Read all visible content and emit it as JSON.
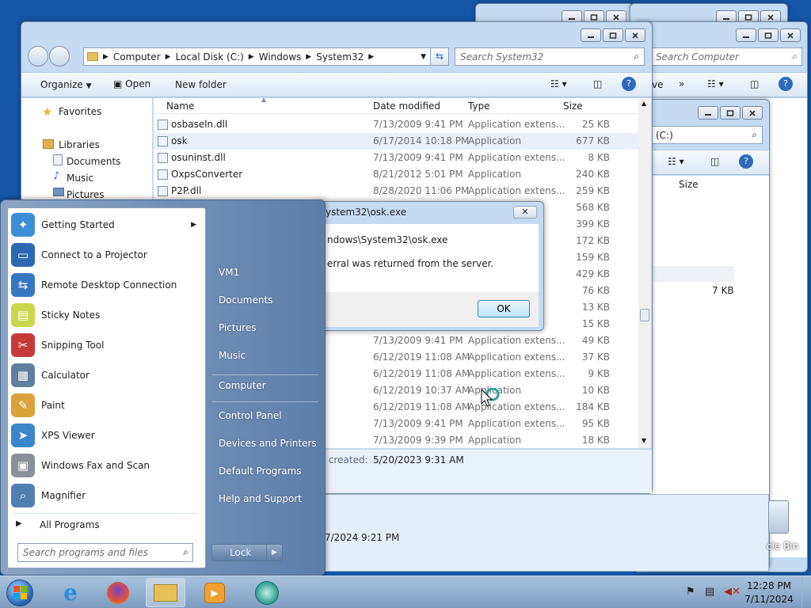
{
  "colors": {
    "desktop": "#1556a6",
    "accent": "#3c7fb1",
    "taskbar": "#8faecf"
  },
  "back_window": {
    "search_placeholder": "Search Computer",
    "toolbar_partial": "ve",
    "column_size": "Size",
    "row_size": "7 KB",
    "date_partial": "7/2024 9:21 PM",
    "drive_partial": "(C:)"
  },
  "recycle_bin": {
    "label": "cle Bin"
  },
  "explorer": {
    "breadcrumb": [
      "Computer",
      "Local Disk (C:)",
      "Windows",
      "System32"
    ],
    "search_placeholder": "Search System32",
    "toolbar": {
      "organize": "Organize",
      "open": "Open",
      "new_folder": "New folder"
    },
    "nav": {
      "favorites": "Favorites",
      "libraries": "Libraries",
      "documents": "Documents",
      "music": "Music",
      "pictures": "Pictures"
    },
    "columns": {
      "name": "Name",
      "date": "Date modified",
      "type": "Type",
      "size": "Size"
    },
    "files": [
      {
        "name": "osbaseln.dll",
        "date": "7/13/2009 9:41 PM",
        "type": "Application extens...",
        "size": "25 KB"
      },
      {
        "name": "osk",
        "date": "6/17/2014 10:18 PM",
        "type": "Application",
        "size": "677 KB"
      },
      {
        "name": "osuninst.dll",
        "date": "7/13/2009 9:41 PM",
        "type": "Application extens...",
        "size": "8 KB"
      },
      {
        "name": "OxpsConverter",
        "date": "8/21/2012 5:01 PM",
        "type": "Application",
        "size": "240 KB"
      },
      {
        "name": "P2P.dll",
        "date": "8/28/2020 11:06 PM",
        "type": "Application extens...",
        "size": "259 KB"
      },
      {
        "name": "",
        "date": "",
        "type": "",
        "size": "568 KB"
      },
      {
        "name": "",
        "date": "",
        "type": "",
        "size": "399 KB"
      },
      {
        "name": "",
        "date": "",
        "type": "",
        "size": "172 KB"
      },
      {
        "name": "",
        "date": "",
        "type": "",
        "size": "159 KB"
      },
      {
        "name": "",
        "date": "",
        "type": "",
        "size": "429 KB"
      },
      {
        "name": "",
        "date": "",
        "type": "",
        "size": "76 KB"
      },
      {
        "name": "",
        "date": "",
        "type": "",
        "size": "13 KB"
      },
      {
        "name": "",
        "date": "",
        "type": "",
        "size": "15 KB"
      },
      {
        "name": "",
        "date": "7/13/2009 9:41 PM",
        "type": "Application extens...",
        "size": "49 KB"
      },
      {
        "name": "",
        "date": "6/12/2019 11:08 AM",
        "type": "Application extens...",
        "size": "37 KB"
      },
      {
        "name": "",
        "date": "6/12/2019 11:08 AM",
        "type": "Application extens...",
        "size": "9 KB"
      },
      {
        "name": "",
        "date": "6/12/2019 10:37 AM",
        "type": "Application",
        "size": "10 KB"
      },
      {
        "name": "",
        "date": "6/12/2019 11:08 AM",
        "type": "Application extens...",
        "size": "184 KB"
      },
      {
        "name": "",
        "date": "7/13/2009 9:41 PM",
        "type": "Application extens...",
        "size": "95 KB"
      },
      {
        "name": "",
        "date": "7/13/2009 9:39 PM",
        "type": "Application",
        "size": "18 KB"
      }
    ],
    "details": {
      "label_partial": "te created:",
      "value": "5/20/2023 9:31 AM"
    }
  },
  "dialog": {
    "title_partial": "ystem32\\osk.exe",
    "path_partial": "ndows\\System32\\osk.exe",
    "message_partial": "erral was returned from the server.",
    "ok": "OK"
  },
  "start_menu": {
    "programs": [
      {
        "label": "Getting Started",
        "icon": "getting-started-icon",
        "color": "#3c8fd6",
        "glyph": "✦",
        "arrow": true
      },
      {
        "label": "Connect to a Projector",
        "icon": "projector-icon",
        "color": "#2b6ab3",
        "glyph": "▭",
        "arrow": false
      },
      {
        "label": "Remote Desktop Connection",
        "icon": "remote-desktop-icon",
        "color": "#3677c2",
        "glyph": "⇆",
        "arrow": false
      },
      {
        "label": "Sticky Notes",
        "icon": "sticky-notes-icon",
        "color": "#c8d84a",
        "glyph": "▤",
        "arrow": false
      },
      {
        "label": "Snipping Tool",
        "icon": "snipping-tool-icon",
        "color": "#c83a3a",
        "glyph": "✂",
        "arrow": false
      },
      {
        "label": "Calculator",
        "icon": "calculator-icon",
        "color": "#5e7f9e",
        "glyph": "▦",
        "arrow": false
      },
      {
        "label": "Paint",
        "icon": "paint-icon",
        "color": "#d9a23a",
        "glyph": "✎",
        "arrow": false
      },
      {
        "label": "XPS Viewer",
        "icon": "xps-viewer-icon",
        "color": "#3a86c8",
        "glyph": "➤",
        "arrow": false
      },
      {
        "label": "Windows Fax and Scan",
        "icon": "fax-scan-icon",
        "color": "#8a8f99",
        "glyph": "▣",
        "arrow": false
      },
      {
        "label": "Magnifier",
        "icon": "magnifier-icon",
        "color": "#4f7fb0",
        "glyph": "⌕",
        "arrow": false
      }
    ],
    "all_programs": "All Programs",
    "search_placeholder": "Search programs and files",
    "right": [
      "VM1",
      "Documents",
      "Pictures",
      "Music",
      "Computer",
      "Control Panel",
      "Devices and Printers",
      "Default Programs",
      "Help and Support"
    ],
    "lock": "Lock"
  },
  "taskbar": {
    "apps": [
      "start-orb-icon",
      "internet-explorer-icon",
      "firefox-icon",
      "windows-explorer-icon",
      "media-player-icon",
      "magnifier-taskbar-icon"
    ],
    "time": "12:28 PM",
    "date": "7/11/2024"
  }
}
